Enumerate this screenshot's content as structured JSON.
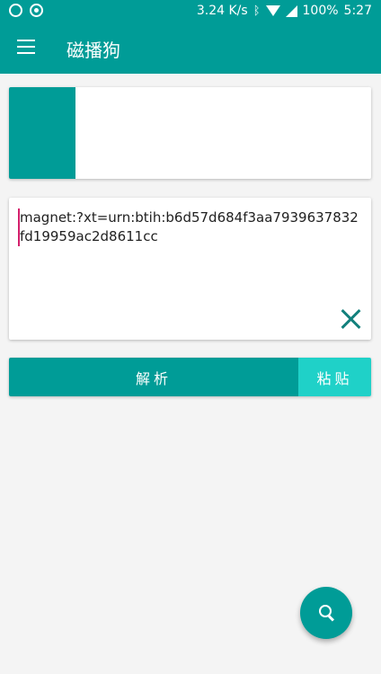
{
  "status_bar": {
    "speed": "3.24 K/s",
    "battery": "100%",
    "time": "5:27",
    "icons": [
      "app-notification-icon",
      "circle-notification-icon",
      "bluetooth-icon",
      "wifi-icon",
      "signal-icon",
      "battery-icon"
    ]
  },
  "toolbar": {
    "title": "磁播狗",
    "menu_icon": "hamburger-menu-icon"
  },
  "input": {
    "value": "magnet:?xt=urn:btih:b6d57d684f3aa7939637832fd19959ac2d8611cc",
    "clear_icon": "close-icon"
  },
  "actions": {
    "parse_label": "解析",
    "paste_label": "粘贴"
  },
  "fab": {
    "icon": "search-icon"
  },
  "colors": {
    "primary": "#009c97",
    "accent": "#1fd1c8",
    "cursor": "#d4206c"
  }
}
